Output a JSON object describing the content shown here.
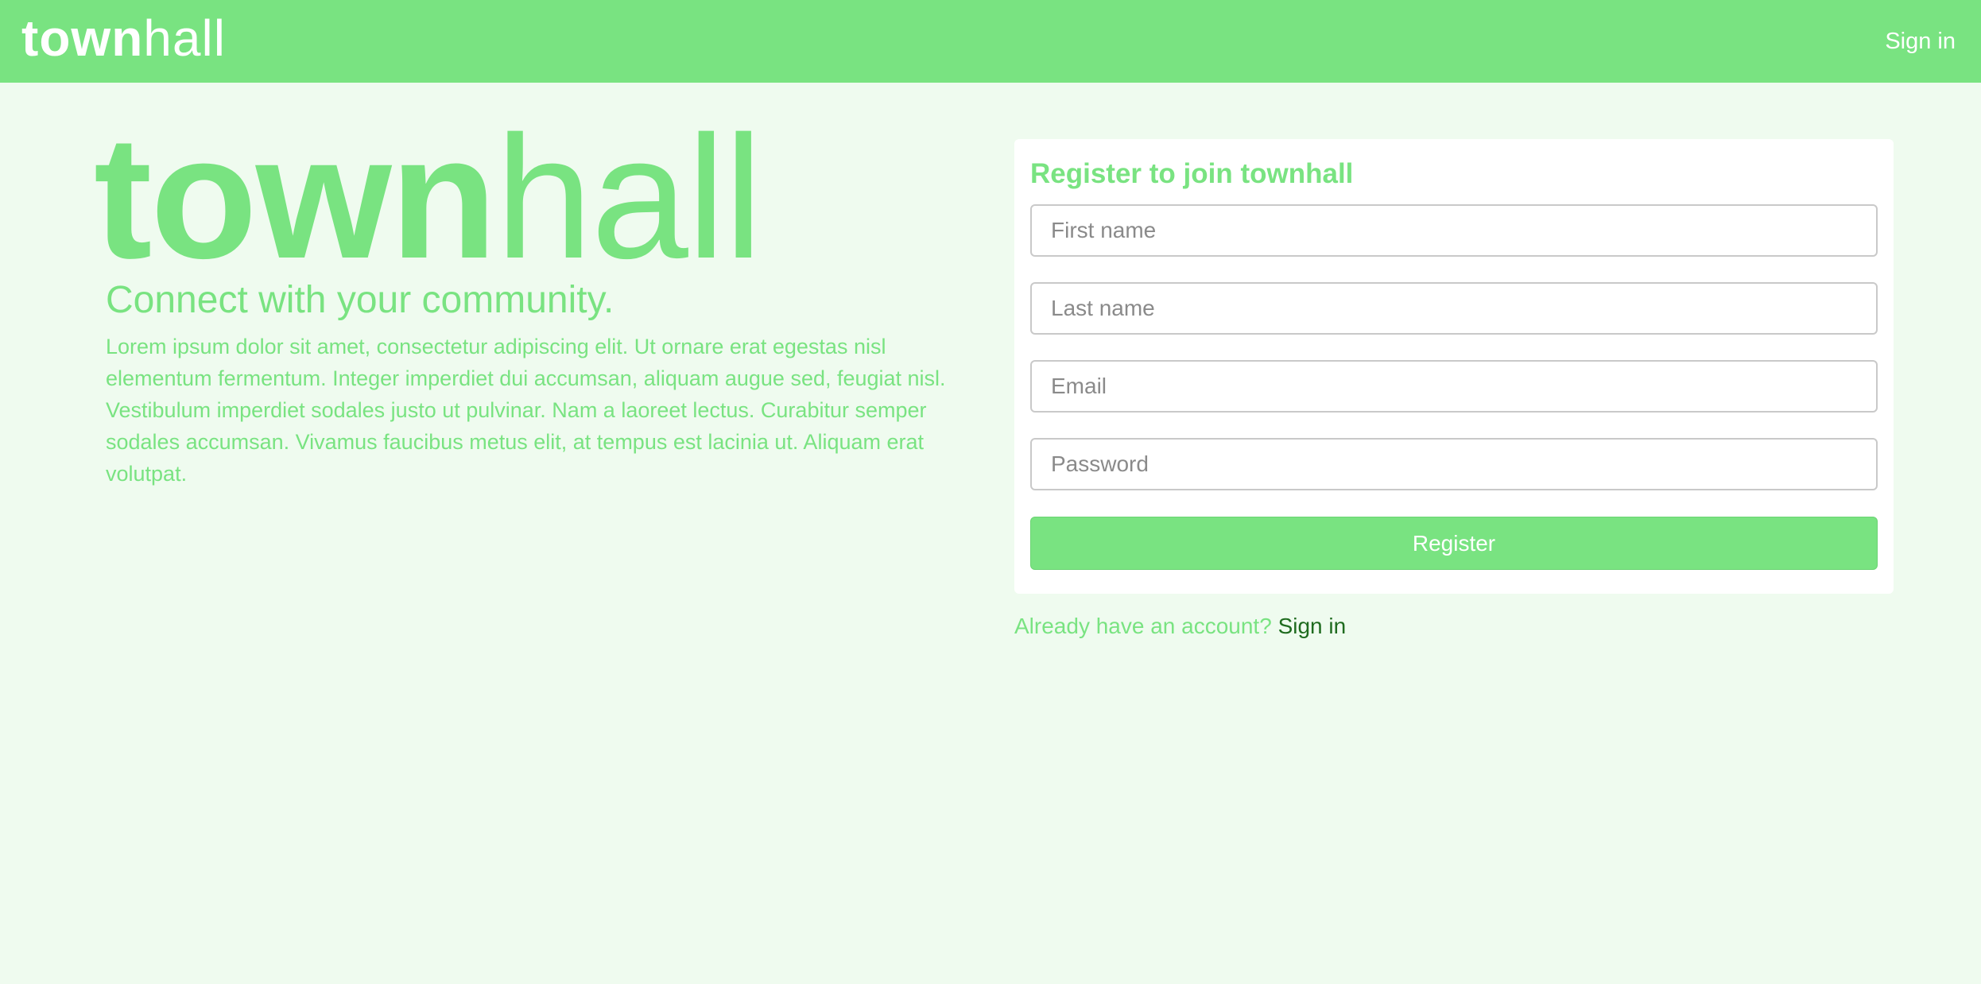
{
  "navbar": {
    "logo_bold": "town",
    "logo_light": "hall",
    "signin_label": "Sign in"
  },
  "hero": {
    "logo_bold": "town",
    "logo_light": "hall",
    "tagline": "Connect with your community.",
    "body": "Lorem ipsum dolor sit amet, consectetur adipiscing elit. Ut ornare erat egestas nisl elementum fermentum. Integer imperdiet dui accumsan, aliquam augue sed, feugiat nisl. Vestibulum imperdiet sodales justo ut pulvinar. Nam a laoreet lectus. Curabitur semper sodales accumsan. Vivamus faucibus metus elit, at tempus est lacinia ut. Aliquam erat volutpat."
  },
  "register": {
    "title": "Register to join townhall",
    "fields": {
      "first_name": {
        "placeholder": "First name",
        "value": ""
      },
      "last_name": {
        "placeholder": "Last name",
        "value": ""
      },
      "email": {
        "placeholder": "Email",
        "value": ""
      },
      "password": {
        "placeholder": "Password",
        "value": ""
      }
    },
    "submit_label": "Register"
  },
  "footer_prompt": {
    "text": "Already have an account?",
    "link_label": "Sign in"
  },
  "colors": {
    "brand_green": "#79e381",
    "page_background": "#effbef",
    "link_dark_green": "#1f6b1f"
  }
}
